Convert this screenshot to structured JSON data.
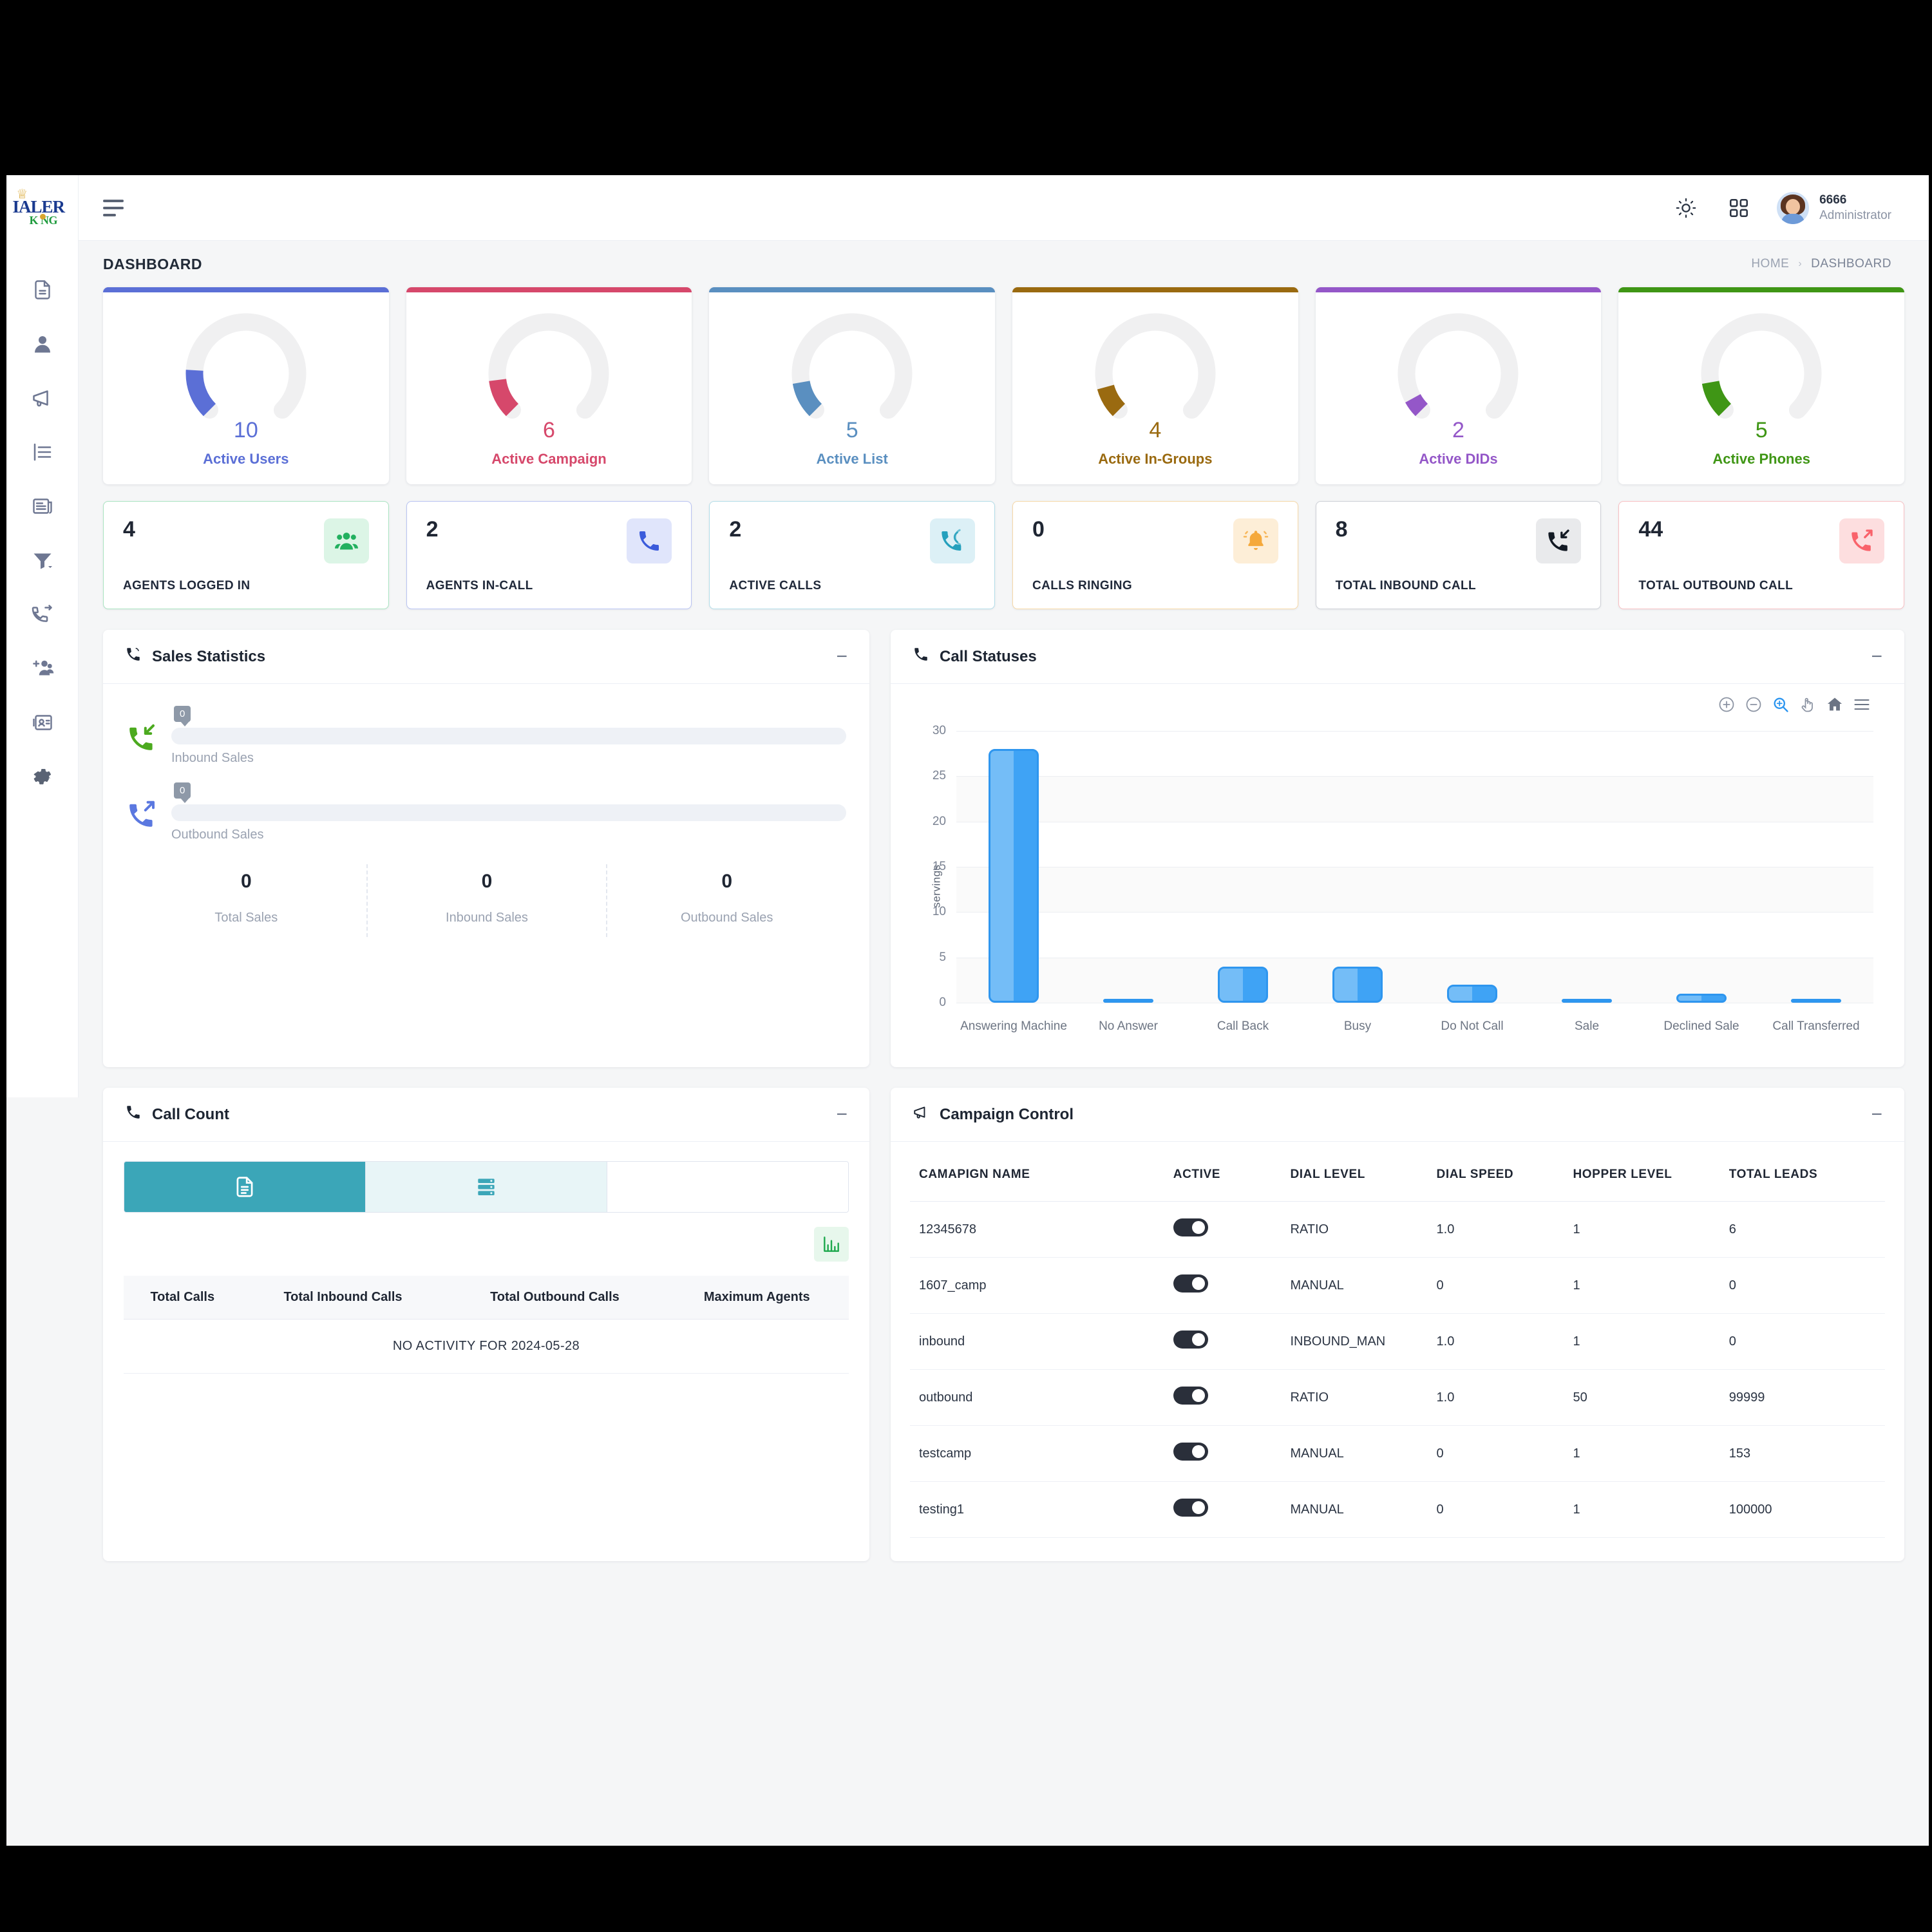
{
  "brand": {
    "crown": "♕",
    "main": "IALER",
    "sub": "K NG"
  },
  "topbar": {
    "theme_icon": "sun-icon",
    "apps_icon": "grid-apps-icon",
    "user_id": "6666",
    "user_role": "Administrator"
  },
  "page": {
    "title": "DASHBOARD",
    "breadcrumb": {
      "home": "HOME",
      "separator": "›",
      "current": "DASHBOARD"
    }
  },
  "sidebar": {
    "items": [
      {
        "name": "sidebar-item-reports",
        "icon": "document-report-icon"
      },
      {
        "name": "sidebar-item-users",
        "icon": "user-icon"
      },
      {
        "name": "sidebar-item-campaigns",
        "icon": "megaphone-icon"
      },
      {
        "name": "sidebar-item-lists",
        "icon": "list-icon"
      },
      {
        "name": "sidebar-item-scripts",
        "icon": "article-icon"
      },
      {
        "name": "sidebar-item-filters",
        "icon": "filter-icon"
      },
      {
        "name": "sidebar-item-callback",
        "icon": "call-transfer-icon"
      },
      {
        "name": "sidebar-item-ingroups",
        "icon": "add-users-icon"
      },
      {
        "name": "sidebar-item-contacts",
        "icon": "id-card-icon"
      },
      {
        "name": "sidebar-item-settings",
        "icon": "gear-icon"
      }
    ]
  },
  "gauges": [
    {
      "value": "10",
      "label": "Active Users",
      "color": "#5b6fd6",
      "pct": 18
    },
    {
      "value": "6",
      "label": "Active Campaign",
      "color": "#d6486b",
      "pct": 14
    },
    {
      "value": "5",
      "label": "Active List",
      "color": "#5a8fc0",
      "pct": 13
    },
    {
      "value": "4",
      "label": "Active In-Groups",
      "color": "#9a6a10",
      "pct": 11
    },
    {
      "value": "2",
      "label": "Active DIDs",
      "color": "#9457c8",
      "pct": 6
    },
    {
      "value": "5",
      "label": "Active Phones",
      "color": "#3f9615",
      "pct": 13
    }
  ],
  "stats": [
    {
      "value": "4",
      "label": "AGENTS LOGGED IN",
      "icon": "group-people-icon",
      "color": "#22b05f",
      "bg": "#dcf5e6",
      "border": "#a9e3c0"
    },
    {
      "value": "2",
      "label": "AGENTS IN-CALL",
      "icon": "phone-icon",
      "color": "#3b5bdb",
      "bg": "#e0e5fb",
      "border": "#b8c3f2"
    },
    {
      "value": "2",
      "label": "ACTIVE CALLS",
      "icon": "phone-active-icon",
      "color": "#25a0bd",
      "bg": "#dcf0f6",
      "border": "#b2dde8"
    },
    {
      "value": "0",
      "label": "CALLS RINGING",
      "icon": "bell-ringing-icon",
      "color": "#f5a93b",
      "bg": "#fdeed7",
      "border": "#f6d8a6"
    },
    {
      "value": "8",
      "label": "TOTAL INBOUND CALL",
      "icon": "call-inbound-icon",
      "color": "#131a24",
      "bg": "#e9eaec",
      "border": "#cdd0d6"
    },
    {
      "value": "44",
      "label": "TOTAL OUTBOUND CALL",
      "icon": "call-outbound-icon",
      "color": "#f9636b",
      "bg": "#fddedf",
      "border": "#f8bfc2"
    }
  ],
  "sales_statistics": {
    "title": "Sales Statistics",
    "title_icon": "phone-ring-icon",
    "minimize": "−",
    "bars": [
      {
        "badge": "0",
        "label": "Inbound Sales",
        "icon": "call-inbound-icon",
        "pct": 0
      },
      {
        "badge": "0",
        "label": "Outbound Sales",
        "icon": "call-outbound-icon",
        "pct": 0
      }
    ],
    "totals": [
      {
        "value": "0",
        "label": "Total Sales"
      },
      {
        "value": "0",
        "label": "Inbound Sales"
      },
      {
        "value": "0",
        "label": "Outbound Sales"
      }
    ]
  },
  "call_statuses": {
    "title": "Call Statuses",
    "title_icon": "phone-icon",
    "minimize": "−",
    "toolbar": [
      {
        "name": "zoom-in-icon",
        "active": false
      },
      {
        "name": "zoom-out-icon",
        "active": false
      },
      {
        "name": "selection-zoom-icon",
        "active": true
      },
      {
        "name": "pan-hand-icon",
        "active": false
      },
      {
        "name": "home-reset-icon",
        "active": false
      },
      {
        "name": "menu-icon",
        "active": false
      }
    ]
  },
  "chart_data": {
    "type": "bar",
    "title": "Call Statuses",
    "categories": [
      "Answering Machine",
      "No Answer",
      "Call Back",
      "Busy",
      "Do Not Call",
      "Sale",
      "Declined Sale",
      "Call Transferred"
    ],
    "values": [
      28,
      0,
      4,
      4,
      2,
      0,
      1,
      0
    ],
    "series": [
      {
        "name": "servings",
        "values": [
          28,
          0,
          4,
          4,
          2,
          0,
          1,
          0
        ]
      }
    ],
    "xlabel": "",
    "ylabel": "servings",
    "ylim": [
      0,
      30
    ],
    "yticks": [
      0,
      5,
      10,
      15,
      20,
      25,
      30
    ],
    "grid": true,
    "legend": "none",
    "bar_color": "#3fa3f5"
  },
  "call_count": {
    "title": "Call Count",
    "title_icon": "phone-icon",
    "minimize": "−",
    "segments": [
      {
        "name": "segment-report-view",
        "icon": "document-icon",
        "selected": true
      },
      {
        "name": "segment-table-view",
        "icon": "server-list-icon",
        "selected": false
      },
      {
        "name": "segment-empty",
        "icon": "",
        "selected": false
      }
    ],
    "chart_toggle_icon": "bar-chart-icon",
    "columns": [
      "Total Calls",
      "Total Inbound Calls",
      "Total Outbound Calls",
      "Maximum Agents"
    ],
    "empty_message": "NO ACTIVITY FOR 2024-05-28"
  },
  "campaign_control": {
    "title": "Campaign Control",
    "title_icon": "megaphone-icon",
    "minimize": "−",
    "columns": [
      "CAMAPIGN NAME",
      "ACTIVE",
      "DIAL LEVEL",
      "DIAL SPEED",
      "HOPPER LEVEL",
      "TOTAL LEADS"
    ],
    "rows": [
      {
        "name": "12345678",
        "active": true,
        "dial_level": "RATIO",
        "dial_speed": "1.0",
        "hopper_level": "1",
        "total_leads": "6"
      },
      {
        "name": "1607_camp",
        "active": true,
        "dial_level": "MANUAL",
        "dial_speed": "0",
        "hopper_level": "1",
        "total_leads": "0"
      },
      {
        "name": "inbound",
        "active": true,
        "dial_level": "INBOUND_MAN",
        "dial_speed": "1.0",
        "hopper_level": "1",
        "total_leads": "0"
      },
      {
        "name": "outbound",
        "active": true,
        "dial_level": "RATIO",
        "dial_speed": "1.0",
        "hopper_level": "50",
        "total_leads": "99999"
      },
      {
        "name": "testcamp",
        "active": true,
        "dial_level": "MANUAL",
        "dial_speed": "0",
        "hopper_level": "1",
        "total_leads": "153"
      },
      {
        "name": "testing1",
        "active": true,
        "dial_level": "MANUAL",
        "dial_speed": "0",
        "hopper_level": "1",
        "total_leads": "100000"
      }
    ]
  }
}
